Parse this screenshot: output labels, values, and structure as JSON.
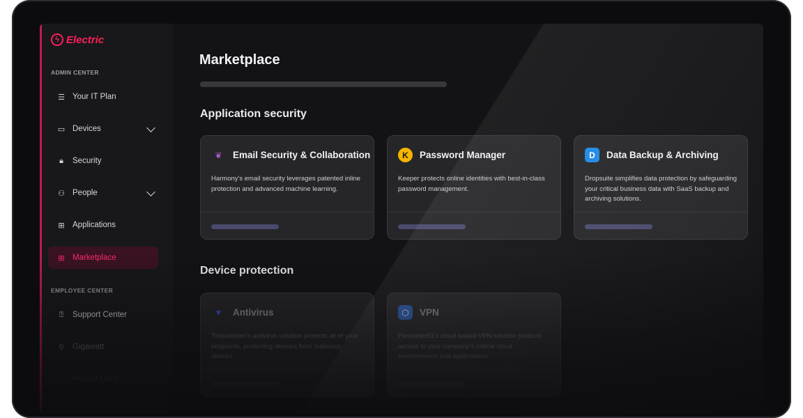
{
  "brand": {
    "name": "Electric",
    "icon": "lightning-bolt-icon",
    "color": "#ff1f5a"
  },
  "sidebar": {
    "admin_label": "ADMIN CENTER",
    "employee_label": "EMPLOYEE CENTER",
    "items": [
      {
        "label": "Your IT Plan",
        "icon": "checklist-icon"
      },
      {
        "label": "Devices",
        "icon": "laptop-icon",
        "expandable": true
      },
      {
        "label": "Security",
        "icon": "lock-icon"
      },
      {
        "label": "People",
        "icon": "people-icon",
        "expandable": true
      },
      {
        "label": "Applications",
        "icon": "apps-grid-icon"
      },
      {
        "label": "Marketplace",
        "icon": "apps-add-icon",
        "active": true
      }
    ],
    "employee_items": [
      {
        "label": "Support Center",
        "icon": "help-chat-icon"
      },
      {
        "label": "Gigawatt",
        "icon": "running-person-icon"
      },
      {
        "label": "Helpful Links",
        "icon": "info-icon"
      }
    ]
  },
  "main": {
    "title": "Marketplace",
    "sections": [
      {
        "heading": "Application security",
        "cards": [
          {
            "title": "Email Security & Collaboration",
            "icon": "harmony-lotus-icon",
            "description": "Harmony's email security leverages patented inline protection and advanced machine learning."
          },
          {
            "title": "Password Manager",
            "icon": "keeper-key-icon",
            "description": "Keeper protects online identities with best-in-class password management."
          },
          {
            "title": "Data Backup & Archiving",
            "icon": "dropsuite-icon",
            "description": "Dropsuite simplifies data protection by safeguarding your critical business data with SaaS backup and archiving solutions."
          }
        ]
      },
      {
        "heading": "Device protection",
        "cards": [
          {
            "title": "Antivirus",
            "icon": "threatdown-chevron-icon",
            "description": "Threatdown's antivirus solution protects all of your endpoints, protecting devices from malicious attacks."
          },
          {
            "title": "VPN",
            "icon": "perimeter81-cube-icon",
            "description": "Perimeter81's cloud based VPN solution protects access to your company's critical cloud environments and applications."
          }
        ]
      }
    ]
  },
  "colors": {
    "accent": "#ff1f5a",
    "active_bg": "#3a1222",
    "card_bg": "#262629",
    "button_placeholder": "#4a4a6e"
  }
}
